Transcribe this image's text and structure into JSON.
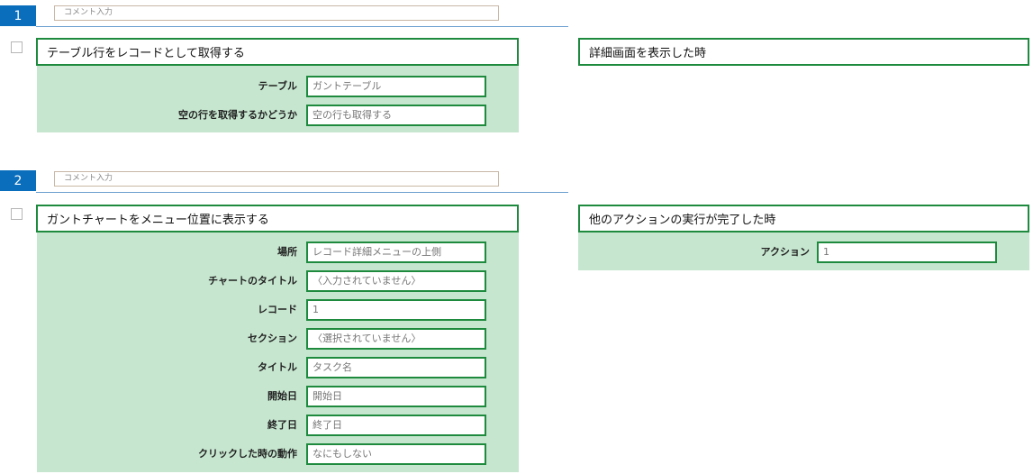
{
  "steps": [
    {
      "number": "1",
      "comment_placeholder": "コメント入力",
      "action": {
        "title": "テーブル行をレコードとして取得する",
        "params": [
          {
            "label": "テーブル",
            "value": "ガントテーブル"
          },
          {
            "label": "空の行を取得するかどうか",
            "value": "空の行も取得する"
          }
        ]
      },
      "trigger": {
        "title": "詳細画面を表示した時",
        "params": []
      }
    },
    {
      "number": "2",
      "comment_placeholder": "コメント入力",
      "action": {
        "title": "ガントチャートをメニュー位置に表示する",
        "params": [
          {
            "label": "場所",
            "value": "レコード詳細メニューの上側"
          },
          {
            "label": "チャートのタイトル",
            "value": "〈入力されていません〉"
          },
          {
            "label": "レコード",
            "value": "1"
          },
          {
            "label": "セクション",
            "value": "〈選択されていません〉"
          },
          {
            "label": "タイトル",
            "value": "タスク名"
          },
          {
            "label": "開始日",
            "value": "開始日"
          },
          {
            "label": "終了日",
            "value": "終了日"
          },
          {
            "label": "クリックした時の動作",
            "value": "なにもしない"
          }
        ]
      },
      "trigger": {
        "title": "他のアクションの実行が完了した時",
        "params": [
          {
            "label": "アクション",
            "value": "1"
          }
        ]
      }
    }
  ]
}
